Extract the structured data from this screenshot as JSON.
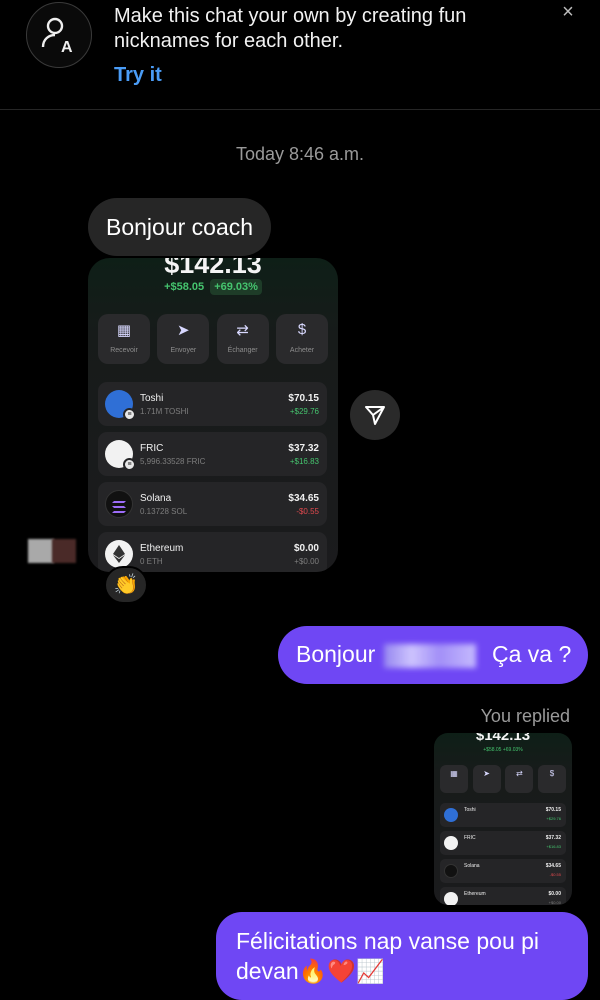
{
  "banner": {
    "text": "Make this chat your own by creating fun nicknames for each other.",
    "action": "Try it",
    "close": "×"
  },
  "timestamp": "Today 8:46 a.m.",
  "messages": {
    "received_text": "Bonjour coach",
    "reaction_emoji": "👏",
    "sent_1_part1": "Bonjour",
    "sent_1_part2": "Ça va ?",
    "replied_label": "You replied",
    "sent_2": "Félicitations nap vanse pou pi devan🔥❤️📈"
  },
  "wallet": {
    "balance": "$142.13",
    "change": "+$58.05",
    "change_pct": "+69.03%",
    "actions": [
      {
        "icon": "qr-icon",
        "glyph": "▦",
        "label": "Recevoir"
      },
      {
        "icon": "send-icon",
        "glyph": "➤",
        "label": "Envoyer"
      },
      {
        "icon": "exchange-icon",
        "glyph": "⇄",
        "label": "Échanger"
      },
      {
        "icon": "dollar-icon",
        "glyph": "$",
        "label": "Acheter"
      }
    ],
    "coins": [
      {
        "name": "Toshi",
        "amount": "1.71M TOSHI",
        "value": "$70.15",
        "change": "+$29.76",
        "trend": "pos",
        "color": "#2f6fd6"
      },
      {
        "name": "FRIC",
        "amount": "5,996.33528 FRIC",
        "value": "$37.32",
        "change": "+$16.83",
        "trend": "pos",
        "color": "#f2f2f2"
      },
      {
        "name": "Solana",
        "amount": "0.13728 SOL",
        "value": "$34.65",
        "change": "-$0.55",
        "trend": "neg",
        "color": "#111111"
      },
      {
        "name": "Ethereum",
        "amount": "0 ETH",
        "value": "$0.00",
        "change": "+$0.00",
        "trend": "mut",
        "color": "#f2f2f2"
      }
    ]
  },
  "colors": {
    "accent": "#6f47f4",
    "link": "#4a9cf6",
    "bubble_in": "#262626",
    "positive": "#45c46e",
    "negative": "#e0494e"
  }
}
